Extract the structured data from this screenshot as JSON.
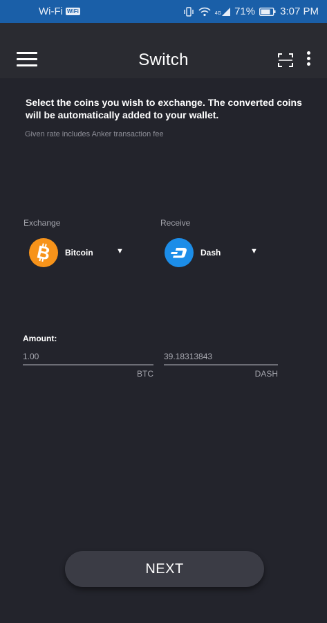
{
  "statusbar": {
    "wifi_label": "Wi-Fi",
    "wifi_badge": "WiFi",
    "network_badge": "4G",
    "battery": "71%",
    "time": "3:07 PM"
  },
  "header": {
    "title": "Switch",
    "menu_icon": "hamburger-menu-icon",
    "scan_icon": "scan-icon",
    "more_icon": "more-vert-icon"
  },
  "intro": {
    "message": "Select the coins you wish to exchange. The converted coins will be automatically added to your wallet.",
    "fee_note": "Given rate includes Anker transaction fee"
  },
  "exchange": {
    "label": "Exchange",
    "coin": "Bitcoin",
    "icon": "bitcoin-icon",
    "color": "#f7931a"
  },
  "receive": {
    "label": "Receive",
    "coin": "Dash",
    "icon": "dash-icon",
    "color": "#1c8de8"
  },
  "amount": {
    "label": "Amount:",
    "from_value": "1.00",
    "from_unit": "BTC",
    "to_value": "39.18313843",
    "to_unit": "DASH"
  },
  "actions": {
    "next_label": "NEXT"
  }
}
